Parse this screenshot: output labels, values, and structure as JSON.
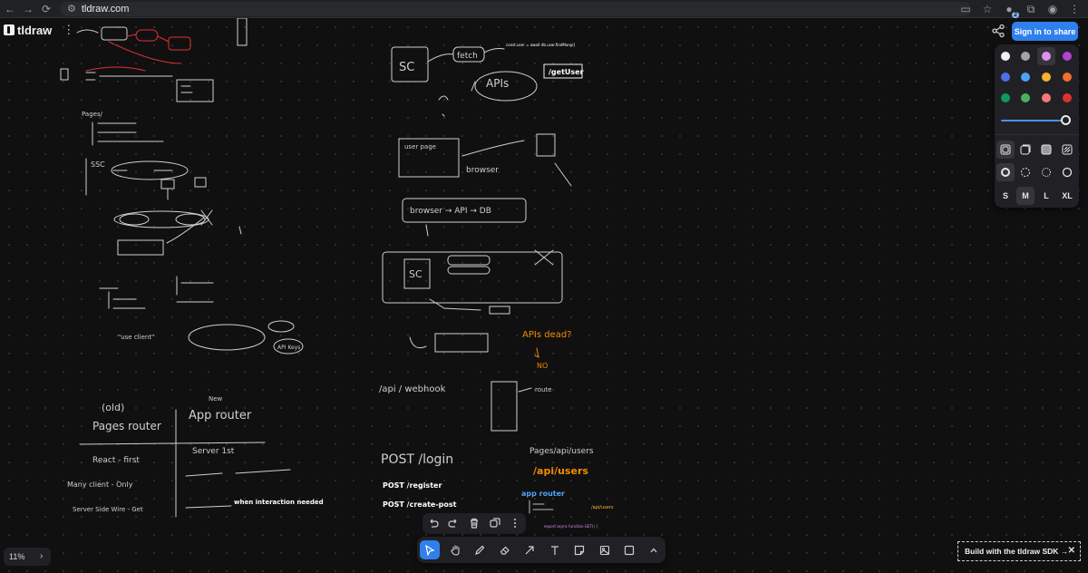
{
  "browser": {
    "url": "tldraw.com",
    "extension_badge": "2"
  },
  "app": {
    "logo_text": "tldraw",
    "sign_in_label": "Sign in to share",
    "zoom_level": "11%",
    "sdk_banner": "Build with the tldraw SDK →"
  },
  "style_panel": {
    "colors": [
      "#f1f1f1",
      "#a3a3a8",
      "#e08ef0",
      "#b145d1",
      "#4f6fe6",
      "#4ea3f5",
      "#f7b22f",
      "#ef7030",
      "#0f9961",
      "#4bb05e",
      "#f87777",
      "#e03131"
    ],
    "selected_color_index": 2,
    "opacity_percent": 100,
    "sizes": [
      "S",
      "M",
      "L",
      "XL"
    ],
    "selected_size": "M"
  },
  "toolbar": {
    "tools": [
      "select-tool",
      "hand-tool",
      "draw-tool",
      "eraser-tool",
      "arrow-tool",
      "text-tool",
      "note-tool",
      "asset-tool",
      "rectangle-tool",
      "more-tools"
    ],
    "active_tool": "select-tool"
  },
  "canvas_text": {
    "code_line": "const user = await db.user.findMany()",
    "get_user": "/getUser",
    "sc_label": "SC",
    "fetch_label": "fetch",
    "apis_label": "APIs",
    "user_page": "user page",
    "browser_label": "browser",
    "flow_label": "browser → API → DB",
    "apis_dead": "APIs dead?",
    "no_label": "NO",
    "old_label": "(old)",
    "pages_router": "Pages router",
    "new_label": "New",
    "app_router": "App router",
    "react_first": "React - first",
    "server_first": "Server 1st",
    "many_client": "Many client - Only",
    "server_side": "Server Side Wire - Get",
    "use_client": "\"use client\"",
    "when_interaction": "when interaction needed",
    "post_login": "POST /login",
    "post_register": "POST /register",
    "post_create": "POST /create-post",
    "pages_api_users": "Pages/api/users",
    "api_users": "/api/users",
    "app_router_title": "app router",
    "api_users_small": "/api/users",
    "export_func": "export async function GET() {",
    "webhook": "/api / webhook",
    "route": "route",
    "ssc": "SSC",
    "api_keys": "API Keys",
    "pages_list": "Pages/"
  }
}
